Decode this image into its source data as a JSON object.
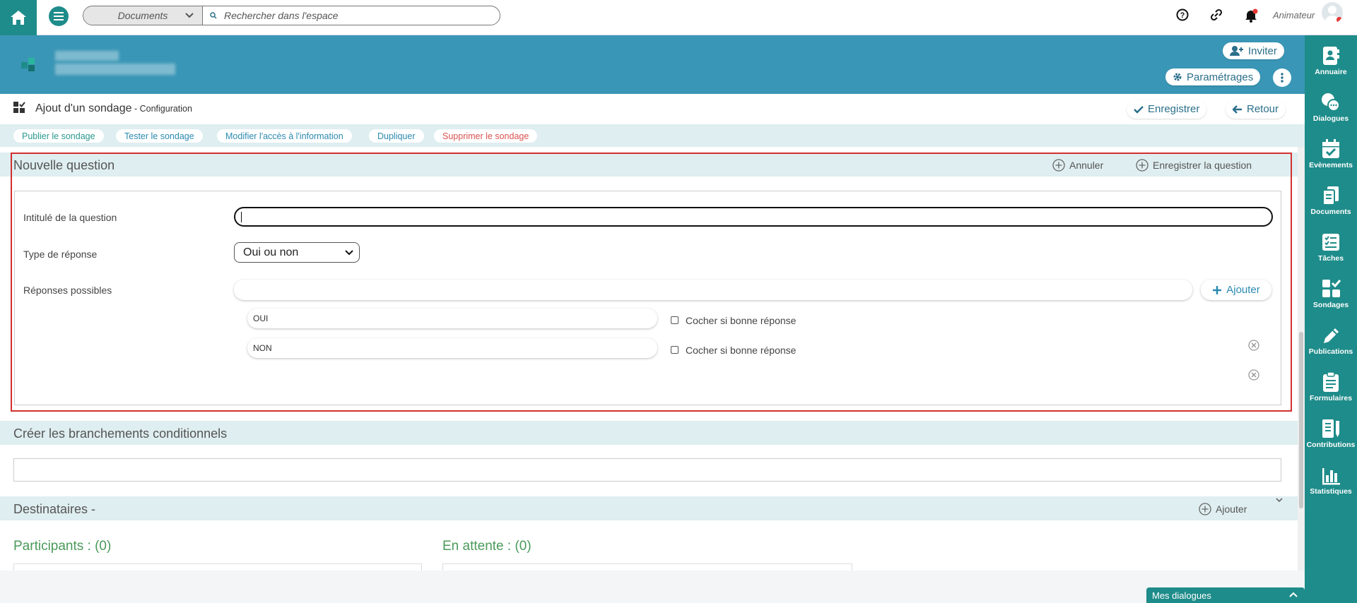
{
  "topbar": {
    "search_scope": "Documents",
    "search_placeholder": "Rechercher dans l'espace",
    "username": "Animateur"
  },
  "banner": {
    "invite_label": "Inviter",
    "settings_label": "Paramétrages"
  },
  "titlebar": {
    "title": "Ajout d'un sondage",
    "subtitle": " - Configuration",
    "save_label": "Enregistrer",
    "back_label": "Retour"
  },
  "actions": [
    {
      "label": "Publier le sondage"
    },
    {
      "label": "Tester le sondage"
    },
    {
      "label": "Modifier l'accès à l'information"
    },
    {
      "label": "Dupliquer"
    },
    {
      "label": "Supprimer le sondage"
    }
  ],
  "question": {
    "section_title": "Nouvelle question",
    "cancel_label": "Annuler",
    "save_question_label": "Enregistrer la question",
    "title_label": "Intitulé de la question",
    "title_value": "",
    "type_label": "Type de réponse",
    "type_value": "Oui ou non",
    "responses_label": "Réponses possibles",
    "add_label": "Ajouter",
    "options": [
      {
        "value": "OUI",
        "check_label": "Cocher si bonne réponse"
      },
      {
        "value": "NON",
        "check_label": "Cocher si bonne réponse"
      }
    ]
  },
  "branches": {
    "section_title": "Créer les branchements conditionnels"
  },
  "recipients": {
    "section_title": "Destinataires -",
    "add_label": "Ajouter",
    "participants": "Participants : (0)",
    "pending": "En attente : (0)"
  },
  "rightbar": {
    "items": [
      {
        "label": "Annuaire",
        "icon": "contact-book-icon"
      },
      {
        "label": "Dialogues",
        "icon": "chat-bubbles-icon"
      },
      {
        "label": "Evènements",
        "icon": "calendar-check-icon"
      },
      {
        "label": "Documents",
        "icon": "documents-icon"
      },
      {
        "label": "Tâches",
        "icon": "checklist-icon"
      },
      {
        "label": "Sondages",
        "icon": "poll-icon"
      },
      {
        "label": "Publications",
        "icon": "pen-icon"
      },
      {
        "label": "Formulaires",
        "icon": "clipboard-icon"
      },
      {
        "label": "Contributions",
        "icon": "contributions-icon"
      },
      {
        "label": "Statistiques",
        "icon": "bar-chart-icon"
      }
    ]
  },
  "footer": {
    "dialogs_label": "Mes dialogues"
  },
  "colors": {
    "teal": "#1e8c8a",
    "banner": "#3a96b6",
    "highlight": "#d32f2f"
  }
}
